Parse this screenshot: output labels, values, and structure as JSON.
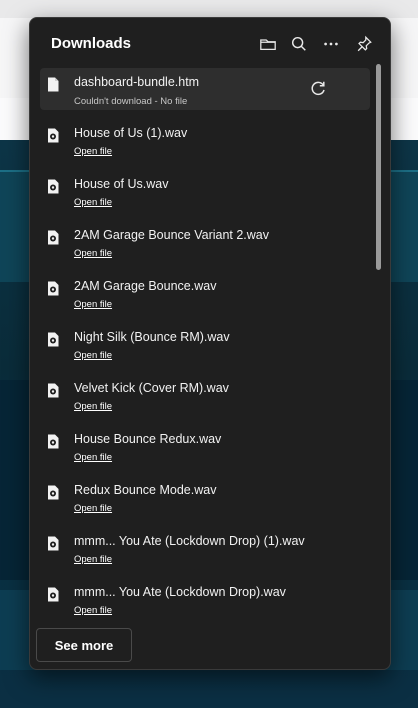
{
  "downloads": {
    "title": "Downloads",
    "header_buttons": [
      "folder-icon",
      "search-icon",
      "more-options-icon",
      "pin-icon"
    ],
    "items": [
      {
        "name": "dashboard-bundle.htm",
        "status": "Couldn't download - No file",
        "failed": true
      },
      {
        "name": "House of Us (1).wav",
        "action": "Open file"
      },
      {
        "name": "House of Us.wav",
        "action": "Open file"
      },
      {
        "name": "2AM Garage Bounce Variant 2.wav",
        "action": "Open file"
      },
      {
        "name": "2AM Garage Bounce.wav",
        "action": "Open file"
      },
      {
        "name": "Night Silk (Bounce RM).wav",
        "action": "Open file"
      },
      {
        "name": "Velvet Kick (Cover RM).wav",
        "action": "Open file"
      },
      {
        "name": "House Bounce Redux.wav",
        "action": "Open file"
      },
      {
        "name": "Redux Bounce Mode.wav",
        "action": "Open file"
      },
      {
        "name": "mmm... You Ate (Lockdown Drop) (1).wav",
        "action": "Open file"
      },
      {
        "name": "mmm... You Ate (Lockdown Drop).wav",
        "action": "Open file"
      }
    ],
    "see_more": "See more"
  }
}
